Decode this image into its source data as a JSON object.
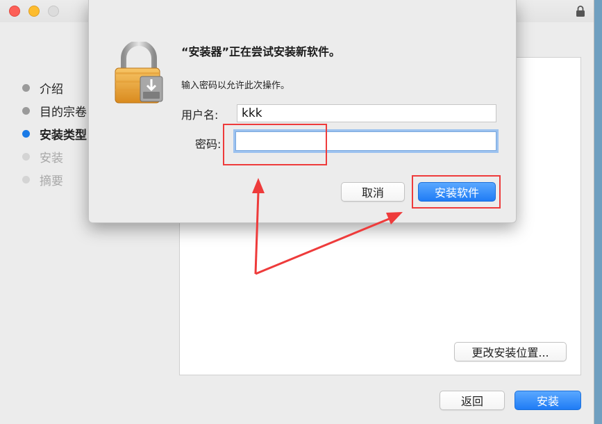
{
  "installer": {
    "steps": [
      {
        "label": "介绍",
        "state": "done"
      },
      {
        "label": "目的宗卷",
        "state": "done"
      },
      {
        "label": "安装类型",
        "state": "active"
      },
      {
        "label": "安装",
        "state": "disabled"
      },
      {
        "label": "摘要",
        "state": "disabled"
      }
    ],
    "change_location_label": "更改安装位置...",
    "back_label": "返回",
    "install_label": "安装"
  },
  "dialog": {
    "title": "“安装器”正在尝试安装新软件。",
    "message": "输入密码以允许此次操作。",
    "username_label": "用户名:",
    "username_value": "kkk",
    "password_label": "密码:",
    "password_value": "",
    "cancel_label": "取消",
    "confirm_label": "安装软件"
  },
  "colors": {
    "accent": "#1f7cf5",
    "annotation": "#ee3b3b",
    "lock_gold": "#f0a63a"
  },
  "icons": [
    "lock-icon",
    "installer-lock-icon"
  ]
}
